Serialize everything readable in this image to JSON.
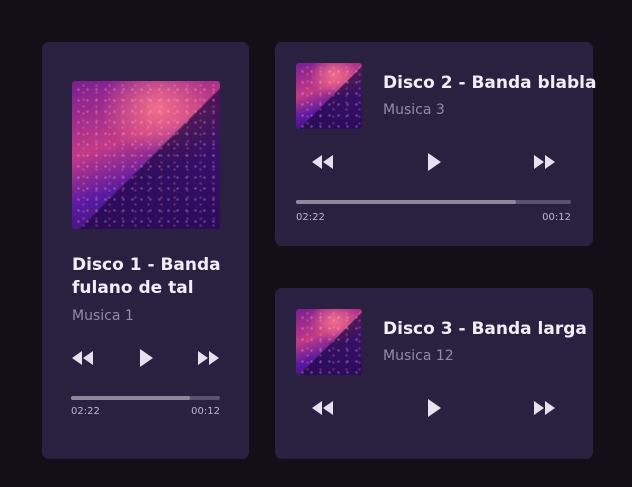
{
  "players": [
    {
      "title": "Disco 1 - Banda fulano de tal",
      "track": "Musica 1",
      "current_time": "02:22",
      "total_time": "00:12",
      "progress": 0.8
    },
    {
      "title": "Disco 2 - Banda blabla",
      "track": "Musica 3",
      "current_time": "02:22",
      "total_time": "00:12",
      "progress": 0.8
    },
    {
      "title": "Disco 3 - Banda larga",
      "track": "Musica 12"
    }
  ],
  "icons": {
    "rewind": "rewind-icon",
    "play": "play-icon",
    "fast_forward": "fast-forward-icon"
  },
  "colors": {
    "background": "#121016",
    "card": "#2a2140",
    "title": "#f2eef8",
    "subtitle": "#948aa8",
    "progress_track": "#5a5370",
    "progress_fill": "#8f889d"
  }
}
